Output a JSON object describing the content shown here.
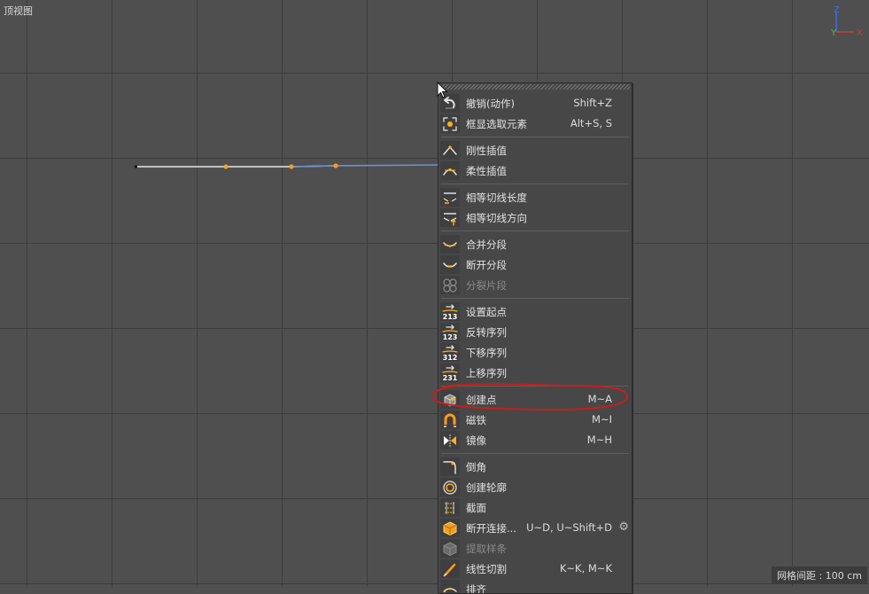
{
  "viewport": {
    "title": "顶视图",
    "grid_spacing": "网格间距 : 100 cm",
    "axis": {
      "z": "Z",
      "y": "Y",
      "x": "X"
    }
  },
  "menu": {
    "groups": [
      [
        {
          "label": "撤销(动作)",
          "shortcut": "Shift+Z",
          "icon": "undo-icon"
        },
        {
          "label": "框显选取元素",
          "shortcut": "Alt+S, S",
          "icon": "frame-selection-icon"
        }
      ],
      [
        {
          "label": "刚性插值",
          "shortcut": "",
          "icon": "hard-interpolation-icon"
        },
        {
          "label": "柔性插值",
          "shortcut": "",
          "icon": "soft-interpolation-icon"
        }
      ],
      [
        {
          "label": "相等切线长度",
          "shortcut": "",
          "icon": "equal-tangent-length-icon"
        },
        {
          "label": "相等切线方向",
          "shortcut": "",
          "icon": "equal-tangent-direction-icon"
        }
      ],
      [
        {
          "label": "合并分段",
          "shortcut": "",
          "icon": "join-segment-icon"
        },
        {
          "label": "断开分段",
          "shortcut": "",
          "icon": "break-segment-icon"
        },
        {
          "label": "分裂片段",
          "shortcut": "",
          "icon": "explode-segments-icon",
          "disabled": true
        }
      ],
      [
        {
          "label": "设置起点",
          "shortcut": "",
          "icon": "set-first-point-icon",
          "numbers": "213"
        },
        {
          "label": "反转序列",
          "shortcut": "",
          "icon": "reverse-sequence-icon",
          "numbers": "123"
        },
        {
          "label": "下移序列",
          "shortcut": "",
          "icon": "move-down-sequence-icon",
          "numbers": "312"
        },
        {
          "label": "上移序列",
          "shortcut": "",
          "icon": "move-up-sequence-icon",
          "numbers": "231"
        }
      ],
      [
        {
          "label": "创建点",
          "shortcut": "M~A",
          "icon": "create-point-icon"
        },
        {
          "label": "磁铁",
          "shortcut": "M~I",
          "icon": "magnet-icon"
        },
        {
          "label": "镜像",
          "shortcut": "M~H",
          "icon": "mirror-icon"
        }
      ],
      [
        {
          "label": "倒角",
          "shortcut": "",
          "icon": "chamfer-icon"
        },
        {
          "label": "创建轮廓",
          "shortcut": "",
          "icon": "create-outline-icon"
        },
        {
          "label": "截面",
          "shortcut": "",
          "icon": "cross-section-icon"
        },
        {
          "label": "断开连接...",
          "shortcut": "U~D, U~Shift+D",
          "icon": "disconnect-icon",
          "gear": true
        },
        {
          "label": "提取样条",
          "shortcut": "",
          "icon": "extract-spline-icon",
          "disabled": true
        },
        {
          "label": "线性切割",
          "shortcut": "K~K, M~K",
          "icon": "line-cut-icon"
        },
        {
          "label": "排齐",
          "shortcut": "",
          "icon": "align-icon"
        }
      ]
    ]
  },
  "colors": {
    "viewport_bg": "#4f4f4f",
    "grid_line": "#3d3d3d",
    "menu_bg": "#474747",
    "spline_selected": "#e6e6e6",
    "spline_blue": "#6f8fd6",
    "spline_point": "#f0a020",
    "annotation_red": "#c81e1e",
    "axis_x": "#d23c3c",
    "axis_y": "#3cc83c",
    "axis_z": "#3c6ee6"
  }
}
